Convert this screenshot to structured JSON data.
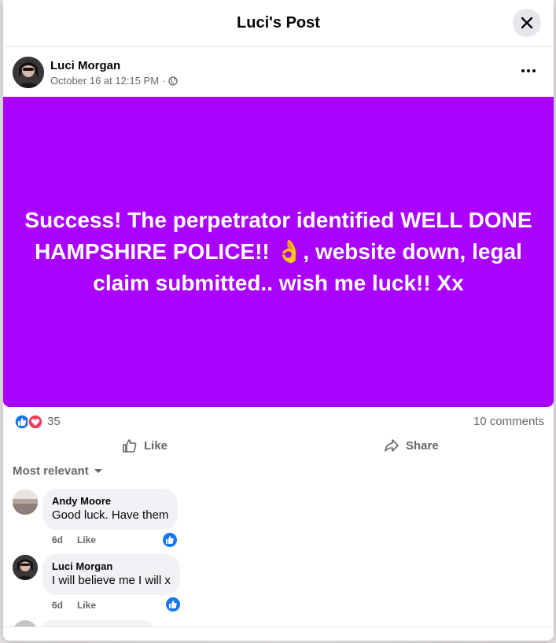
{
  "modal": {
    "title": "Luci's Post"
  },
  "post": {
    "author": "Luci Morgan",
    "timestamp": "October 16 at 12:15 PM",
    "separator": "·",
    "privacy_icon": "globe-icon",
    "text": "Success! The perpetrator identified WELL DONE HAMPSHIRE POLICE!! 👌, website down, legal claim submitted.. wish me luck!! Xx",
    "background_color": "#aa00ff"
  },
  "reactions": {
    "count": "35",
    "icons": [
      "like-reaction-icon",
      "love-reaction-icon"
    ],
    "comments_label": "10 comments"
  },
  "actions": {
    "like": "Like",
    "share": "Share"
  },
  "sort": {
    "label": "Most relevant"
  },
  "comments": [
    {
      "name": "Andy Moore",
      "text": "Good luck. Have them",
      "age": "6d",
      "like": "Like"
    },
    {
      "name": "Luci Morgan",
      "text": "I will believe me I will x",
      "age": "6d",
      "like": "Like"
    }
  ],
  "colors": {
    "accent": "#1877f2",
    "love": "#f33e58",
    "text_secondary": "#65676b"
  }
}
